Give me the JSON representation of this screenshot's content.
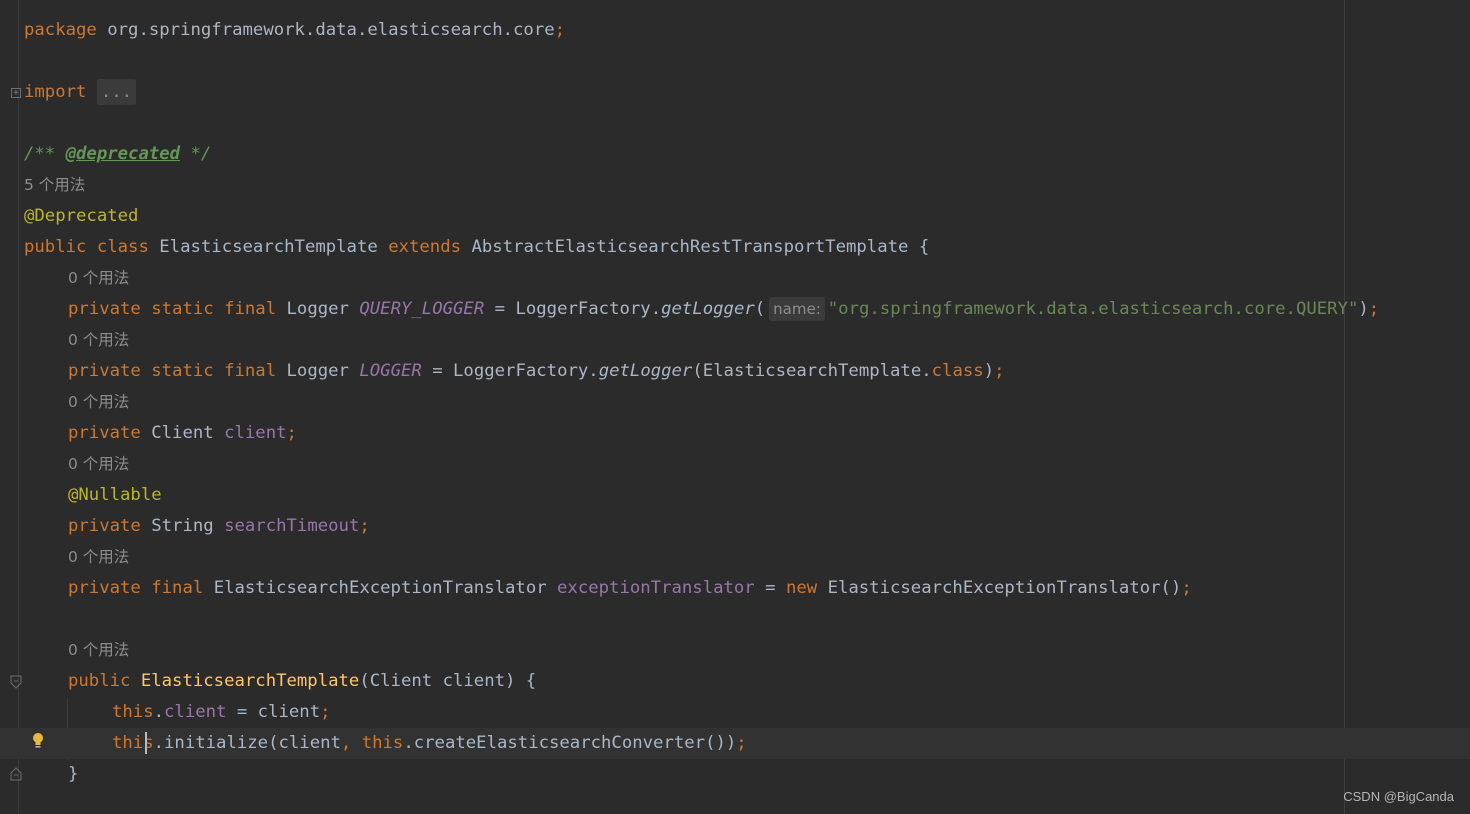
{
  "editor": {
    "package_kw": "package",
    "package_name": "org.springframework.data.elasticsearch.core",
    "import_kw": "import",
    "import_fold": "...",
    "doc_open": "/** ",
    "doc_tag": "@deprecated",
    "doc_close": " */",
    "usages_5": "5 个用法",
    "usages_0": "0 个用法",
    "ann_deprecated": "@Deprecated",
    "class_decl": {
      "public": "public",
      "class": "class",
      "name": "ElasticsearchTemplate",
      "extends": "extends",
      "super": "AbstractElasticsearchRestTransportTemplate",
      "brace": "{"
    },
    "private": "private",
    "static": "static",
    "final": "final",
    "new": "new",
    "this": "this",
    "dot_class": "class",
    "logger_type": "Logger",
    "query_logger": "QUERY_LOGGER",
    "logger": "LOGGER",
    "logger_factory": "LoggerFactory.",
    "get_logger": "getLogger",
    "param_hint": "name:",
    "query_string": "\"org.springframework.data.elasticsearch.core.QUERY\"",
    "template_ref": "ElasticsearchTemplate.",
    "client_type": "Client",
    "client_field": "client",
    "ann_nullable": "@Nullable",
    "string_type": "String",
    "search_timeout": "searchTimeout",
    "translator_type": "ElasticsearchExceptionTranslator",
    "translator_field": "exceptionTranslator",
    "ctor_name": "ElasticsearchTemplate",
    "ctor_params": "(Client client) {",
    "assign_rhs": " = client",
    "initialize_call": ".initialize(client",
    "create_converter": ".createElasticsearchConverter())",
    "close_brace": "}"
  },
  "watermark": "CSDN @BigCanda",
  "icons": [
    "fold-plus-icon",
    "fold-open-icon",
    "fold-close-icon",
    "lightbulb-icon"
  ]
}
